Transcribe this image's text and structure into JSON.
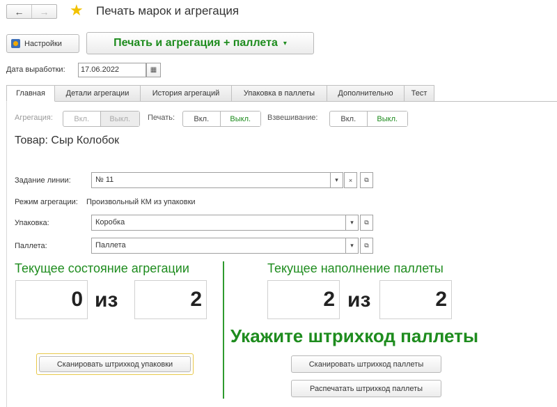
{
  "window": {
    "title": "Печать марок и агрегация",
    "back_glyph": "←",
    "forward_glyph": "→",
    "star_glyph": "★"
  },
  "toolbar": {
    "settings_label": "Настройки",
    "main_button_label": "Печать и агрегация + паллета",
    "main_button_caret": "▾"
  },
  "date": {
    "label": "Дата выработки:",
    "value": "17.06.2022",
    "calendar_glyph": "▦"
  },
  "tabs": [
    {
      "label": "Главная",
      "active": true
    },
    {
      "label": "Детали агрегации"
    },
    {
      "label": "История агрегаций"
    },
    {
      "label": "Упаковка в паллеты"
    },
    {
      "label": "Дополнительно"
    },
    {
      "label": "Тест"
    }
  ],
  "toggles": {
    "aggregation": {
      "label": "Агрегация:",
      "on": "Вкл.",
      "off": "Выкл."
    },
    "print": {
      "label": "Печать:",
      "on": "Вкл.",
      "off": "Выкл."
    },
    "weighing": {
      "label": "Взвешивание:",
      "on": "Вкл.",
      "off": "Выкл."
    }
  },
  "product": {
    "label": "Товар:  Сыр Колобок"
  },
  "form": {
    "line_task": {
      "label": "Задание линии:",
      "value": "№ 11"
    },
    "mode": {
      "label": "Режим агрегации:",
      "value": "Произвольный КМ из упаковки"
    },
    "package": {
      "label": "Упаковка:",
      "value": "Коробка"
    },
    "pallet": {
      "label": "Паллета:",
      "value": "Паллета"
    },
    "dropdown_glyph": "▾",
    "clear_glyph": "×",
    "open_glyph": "⧉"
  },
  "aggregation_state": {
    "heading": "Текущее состояние агрегации",
    "current": "0",
    "separator": "из",
    "total": "2"
  },
  "pallet_state": {
    "heading": "Текущее наполнение паллеты",
    "current": "2",
    "separator": "из",
    "total": "2"
  },
  "prompt": "Укажите штрихкод паллеты",
  "buttons": {
    "scan_package": "Сканировать штрихкод упаковки",
    "scan_pallet": "Сканировать штрихкод паллеты",
    "print_pallet": "Распечатать штрихкод паллеты"
  },
  "colors": {
    "accent_green": "#1e8c1e",
    "star_yellow": "#f2c200",
    "focus_yellow": "#e8c84a"
  }
}
